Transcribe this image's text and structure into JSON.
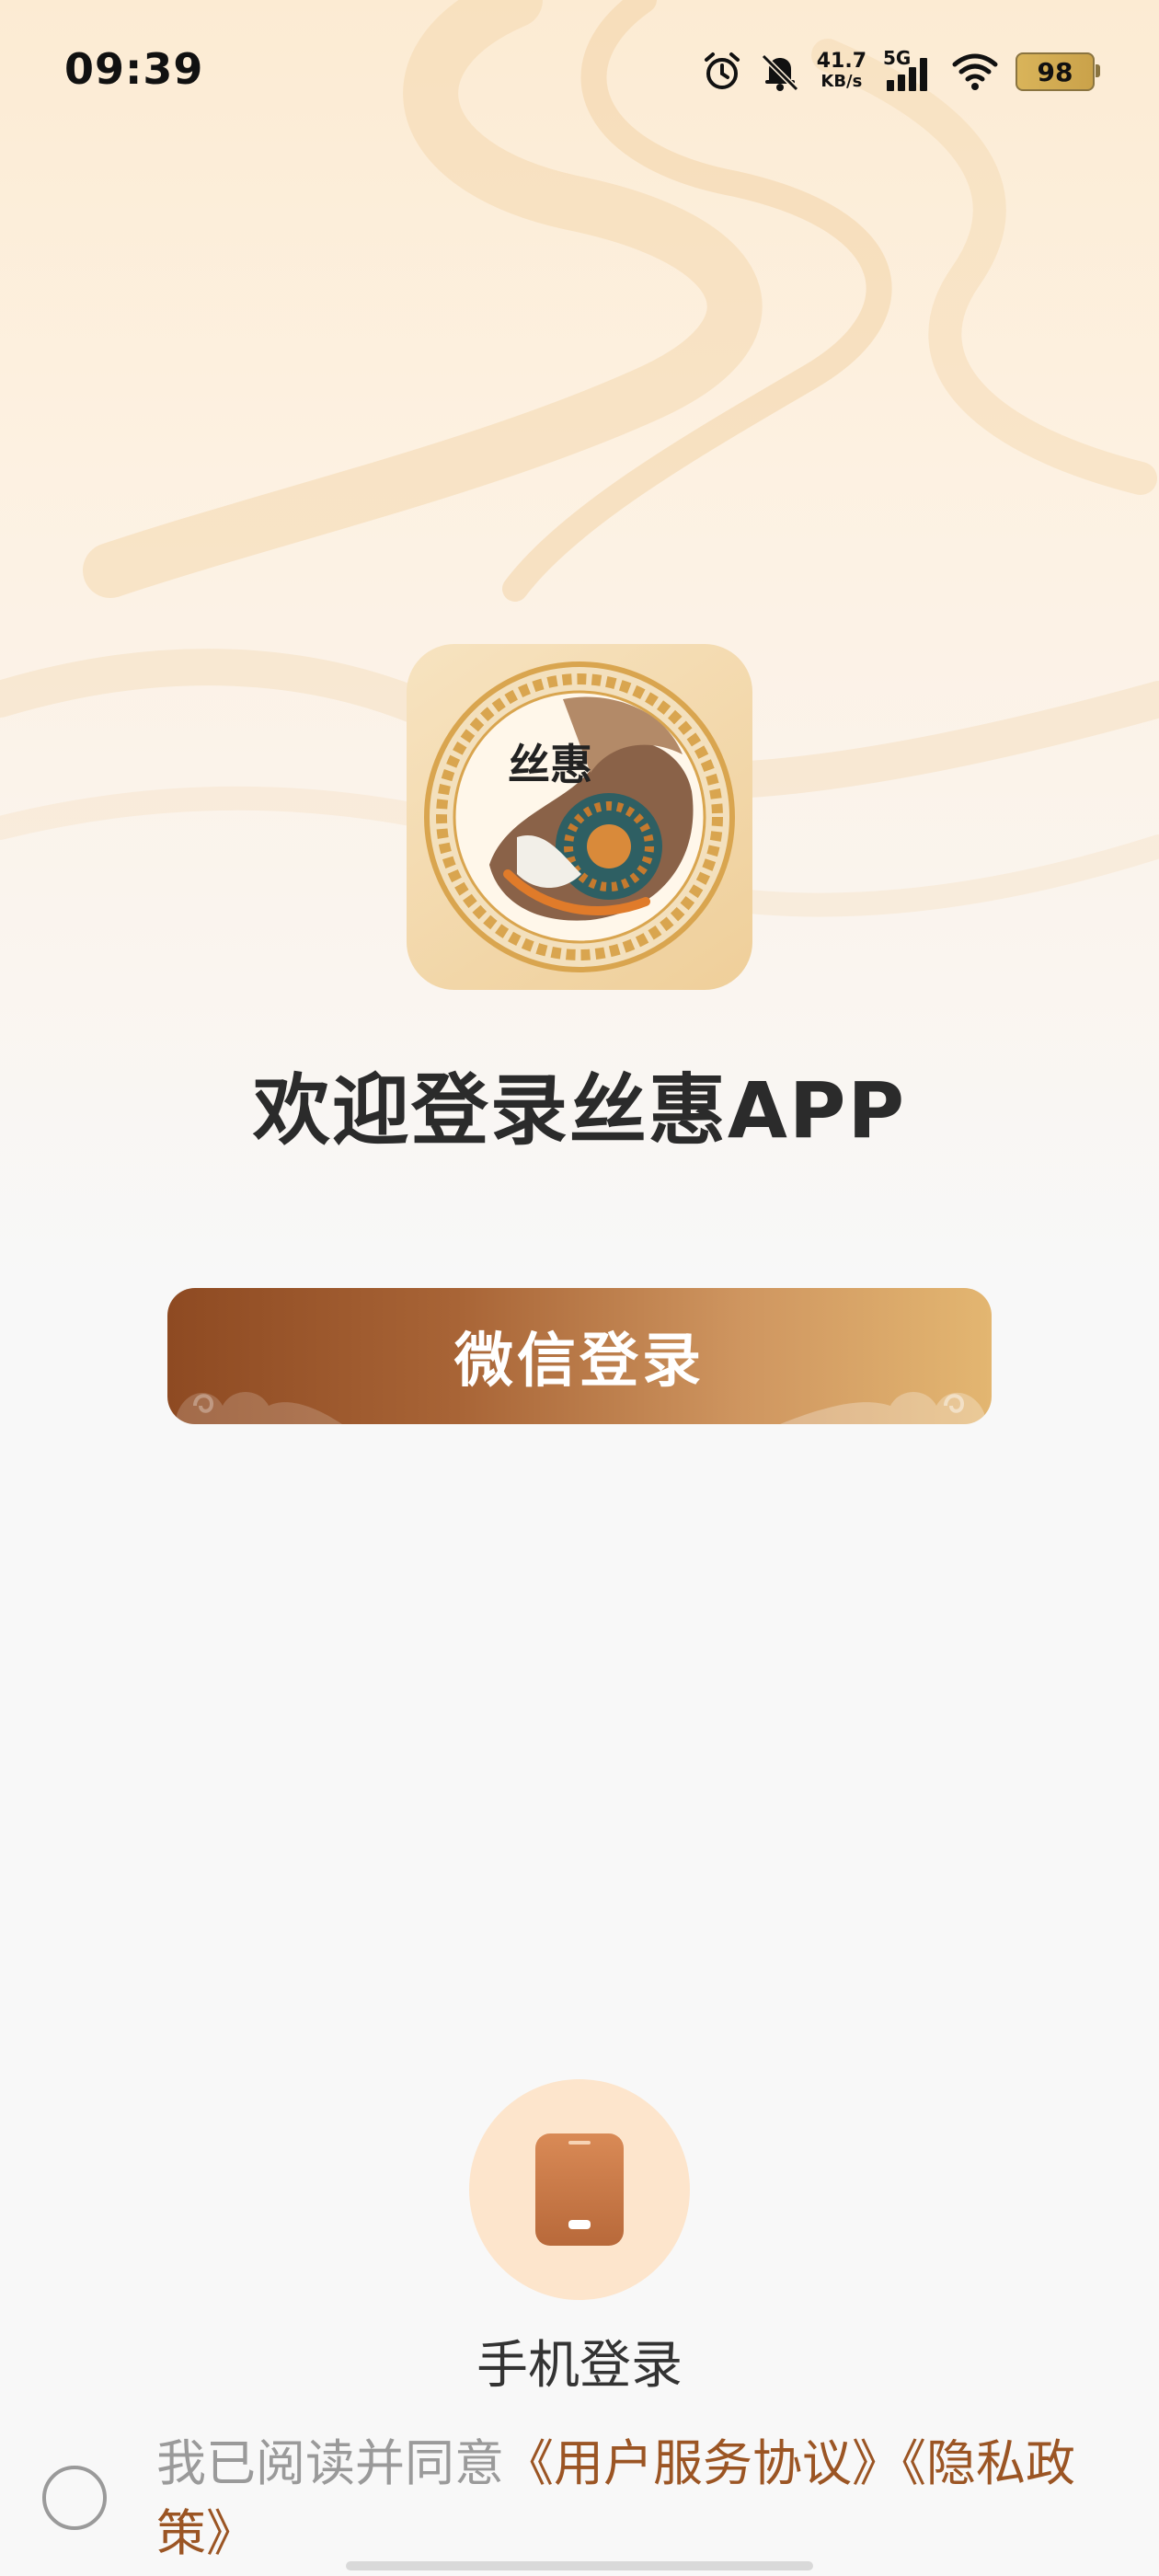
{
  "status_bar": {
    "time": "09:39",
    "network_speed_value": "41.7",
    "network_speed_unit": "KB/s",
    "network_type": "5G",
    "battery_level": "98",
    "icons": [
      "alarm-icon",
      "mute-icon",
      "signal-icon",
      "wifi-icon",
      "battery-icon"
    ]
  },
  "logo": {
    "text": "丝惠"
  },
  "welcome": {
    "title": "欢迎登录丝惠APP"
  },
  "wechat_login": {
    "label": "微信登录"
  },
  "phone_login": {
    "label": "手机登录",
    "icon": "phone-icon"
  },
  "agreement": {
    "prefix": "我已阅读并同意",
    "terms_link": "《用户服务协议》",
    "privacy_link": "《隐私政策》"
  },
  "colors": {
    "accent_brown": "#9b5524",
    "button_start": "#8e4a22",
    "button_end": "#e3b671",
    "phone_circle": "#fde5cc"
  }
}
